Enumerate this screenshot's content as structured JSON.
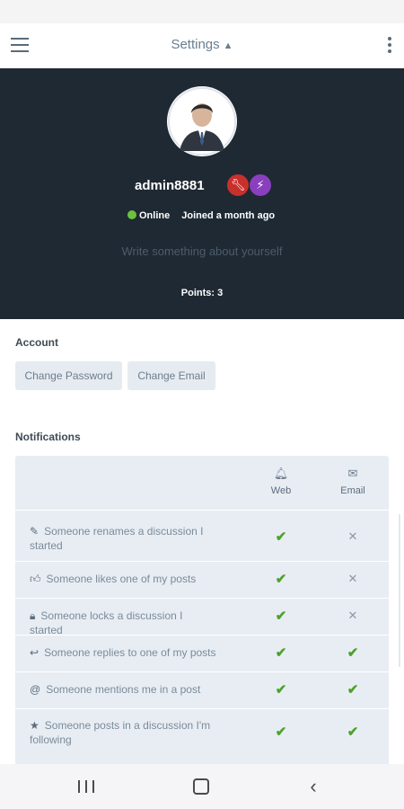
{
  "appbar": {
    "title": "Settings",
    "sort_icon": "sort-icon"
  },
  "profile": {
    "username": "admin8881",
    "status": "Online",
    "joined": "Joined a month ago",
    "bio_placeholder": "Write something about yourself",
    "points": "Points: 3",
    "badges": [
      "wrench-icon",
      "bolt-icon"
    ],
    "badge_colors": [
      "#c9302c",
      "#8a3fbf"
    ]
  },
  "account": {
    "title": "Account",
    "change_password": "Change Password",
    "change_email": "Change Email"
  },
  "notifications": {
    "title": "Notifications",
    "columns": [
      {
        "label": "Web",
        "icon": "bell-icon"
      },
      {
        "label": "Email",
        "icon": "envelope-icon"
      }
    ],
    "rows": [
      {
        "label": "Someone renames a discussion I started",
        "icon": "pencil-icon",
        "web": true,
        "email": false
      },
      {
        "label": "Someone likes one of my posts",
        "icon": "thumbs-up-icon",
        "web": true,
        "email": false
      },
      {
        "label": "Someone locks a discussion I started",
        "icon": "lock-icon",
        "web": true,
        "email": false
      },
      {
        "label": "Someone replies to one of my posts",
        "icon": "reply-icon",
        "web": true,
        "email": true
      },
      {
        "label": "Someone mentions me in a post",
        "icon": "at-icon",
        "web": true,
        "email": true
      },
      {
        "label": "Someone posts in a discussion I'm following",
        "icon": "star-icon",
        "web": true,
        "email": true
      }
    ]
  },
  "colors": {
    "hero_bg": "#1f2933",
    "online": "#6ac23f",
    "check": "#4ca32c"
  }
}
